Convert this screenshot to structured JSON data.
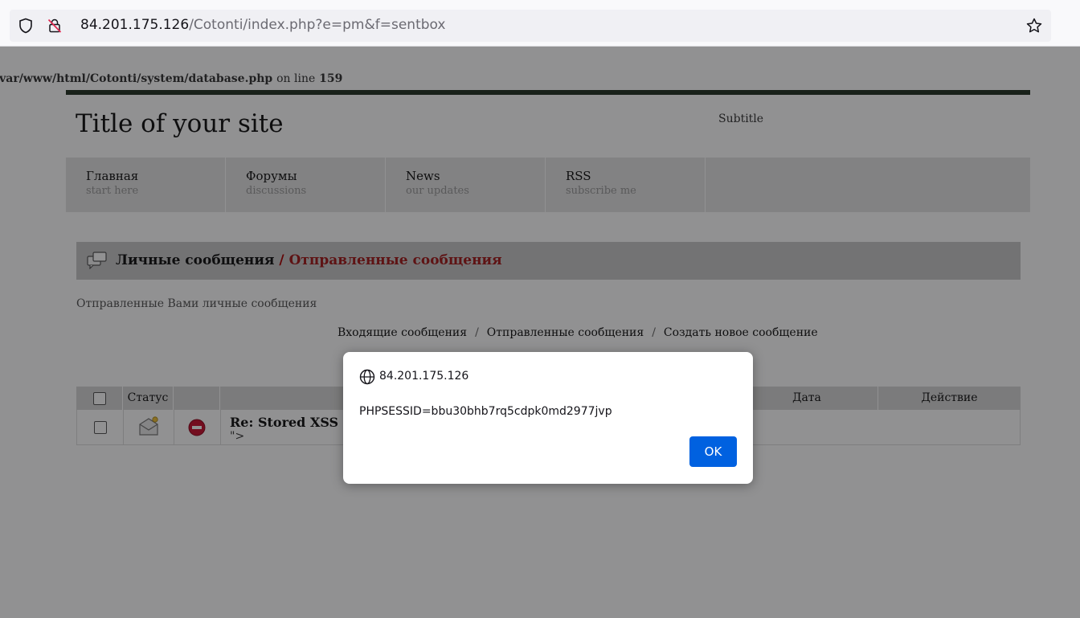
{
  "browser": {
    "url_host": "84.201.175.126",
    "url_path": "/Cotonti/index.php?e=pm&f=sentbox"
  },
  "page": {
    "error": {
      "path": "/var/www/html/Cotonti/system/database.php",
      "on_line": "on line",
      "line_number": "159"
    },
    "site_title": "Title of your site",
    "site_subtitle": "Subtitle",
    "nav": [
      {
        "title": "Главная",
        "sub": "start here"
      },
      {
        "title": "Форумы",
        "sub": "discussions"
      },
      {
        "title": "News",
        "sub": "our updates"
      },
      {
        "title": "RSS",
        "sub": "subscribe me"
      }
    ],
    "block_title": "Личные сообщения",
    "block_separator": "/",
    "block_current": "Отправленные сообщения",
    "description": "Отправленные Вами личные сообщения",
    "pm_links": {
      "inbox": "Входящие сообщения",
      "sent": "Отправленные сообщения",
      "create": "Создать новое сообщение",
      "separator": "/"
    },
    "table": {
      "headers": {
        "status": "Статус",
        "date": "Дата",
        "action": "Действие"
      },
      "rows": [
        {
          "title": "Re: Stored XSS",
          "preview": "\">"
        }
      ]
    }
  },
  "dialog": {
    "origin": "84.201.175.126",
    "message": "PHPSESSID=bbu30bhb7rq5cdpk0md2977jvp",
    "ok_label": "OK"
  },
  "colors": {
    "accent_blue": "#0061e0",
    "breadcrumb_red": "#a21a1a",
    "top_rule": "#263426"
  }
}
